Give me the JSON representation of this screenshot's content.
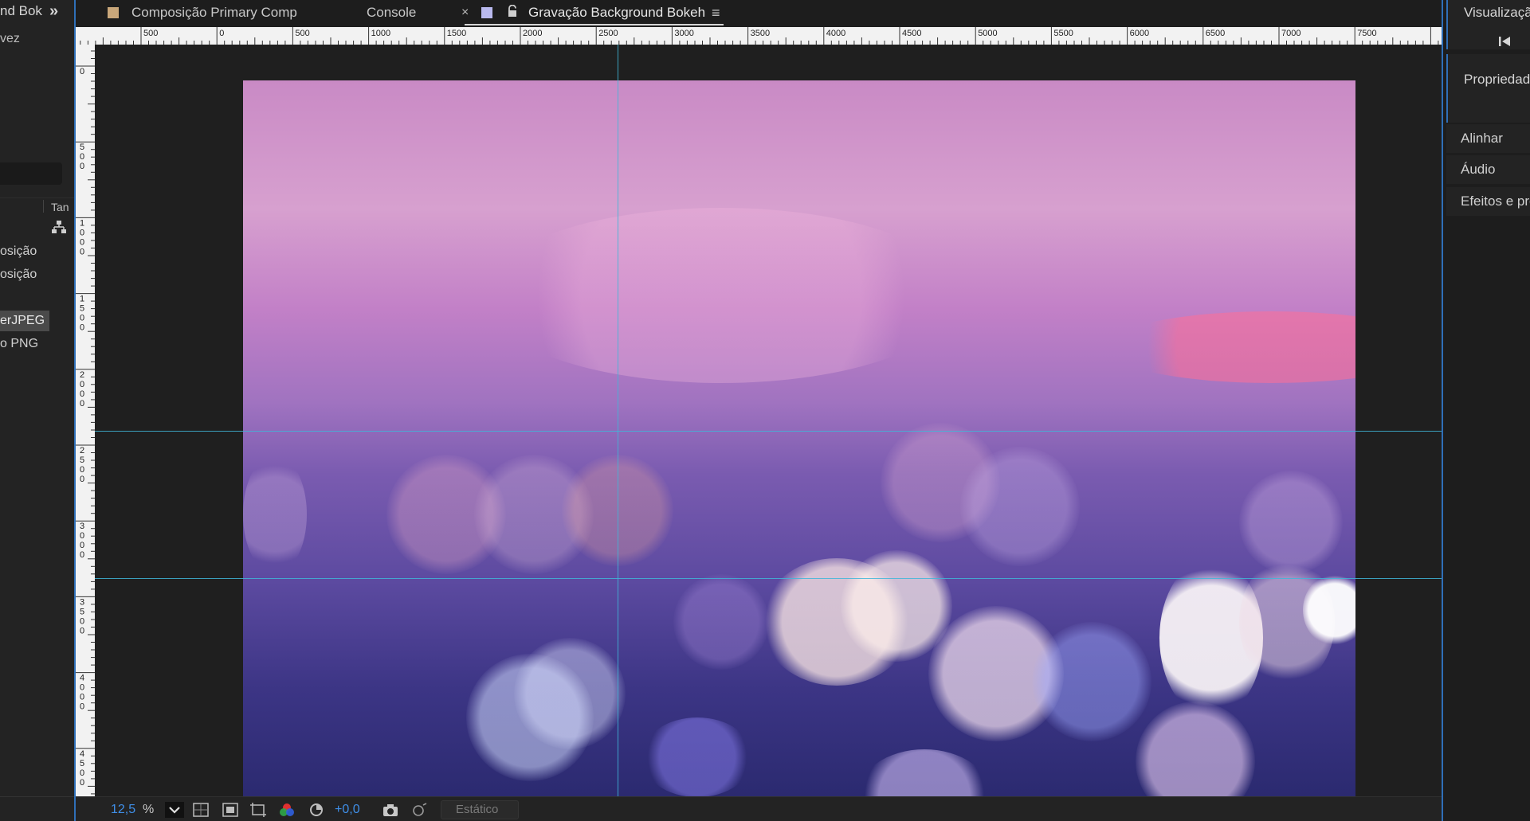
{
  "left_panel": {
    "tab_label": "nd Bok",
    "expand_icon": "double-chevron-right-icon",
    "subtitle": "vez",
    "column_header": "Tan",
    "flowchart_icon": "flowchart-icon",
    "items": [
      {
        "label": "osição"
      },
      {
        "label": "osição"
      },
      {
        "label": "erJPEG",
        "selected": true
      },
      {
        "label": "o PNG"
      }
    ]
  },
  "tabs": [
    {
      "label": "Composição Primary Comp",
      "swatch_color": "#c9a77a"
    },
    {
      "label": "Console"
    },
    {
      "label": "Gravação Background Bokeh",
      "swatch_color": "#b9b9ee",
      "active": true
    }
  ],
  "tab_close": "×",
  "ruler": {
    "h_labels": [
      "500",
      "0",
      "500",
      "1000",
      "1500",
      "2000",
      "2500",
      "3000",
      "3500",
      "4000",
      "4500",
      "5000",
      "5500",
      "6000",
      "6500",
      "7000",
      "7500"
    ],
    "v_labels": [
      "0",
      "500",
      "1000",
      "1500",
      "2000",
      "2500",
      "3000",
      "3500",
      "4000",
      "4500"
    ]
  },
  "viewer": {
    "image_description_icon": "bokeh-image",
    "colors": {
      "guide": "#3fb6d8",
      "panel_accent": "#2f6fb8"
    }
  },
  "toolbar": {
    "zoom_value": "12,5",
    "zoom_unit": "%",
    "exposure_value": "+0,0",
    "resolution": "Estático"
  },
  "right_panel": {
    "preview_title": "Visualizaçã",
    "properties_title": "Propriedade",
    "buttons": [
      "Alinhar",
      "Áudio",
      "Efeitos e pre"
    ]
  }
}
